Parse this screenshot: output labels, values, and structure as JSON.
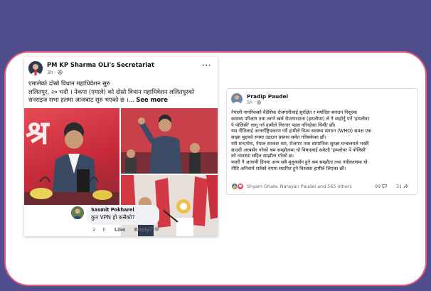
{
  "left_post": {
    "page_name": "PM KP Sharma OLI's Secretariat",
    "time": "3h",
    "privacy_icon": "globe-icon",
    "lines": [
      "एमालेको दोस्रो विधान महाधिवेशन सुरु",
      "ललितपुर, २० भदौ । नेकपा (एमाले) को दोस्रो विधान महाधिवेशन  ललितपुरको",
      "सनराइज सभा हलमा आजबाट सुरु भएको  छ ।..."
    ],
    "see_more": "See more",
    "photo_text": "श्र",
    "comment": {
      "author": "Sasmit Pokharel",
      "text": "कुन VPN हो कसैको?",
      "like": "Like",
      "reply": "Reply",
      "age": "2"
    }
  },
  "right_post": {
    "author": "Pradip Paudel",
    "time": "5h",
    "privacy_icon": "globe-icon",
    "lines": [
      "नेपाली नागरिकको वैदेशिक रोजगारीलाई सुरक्षित  र मर्यादित बनाउन निशुल्क",
      "स्वास्थ्य परिक्षण तथा लाग्ने खर्च रोजगारदाता (इम्प्लोयर) ले नै व्यहोर्नु पर्ने 'इम्प्लोयर",
      "पे पोलिसी' लागु गर्न हामीले निरन्तर पहल गरिरहेका थियौं/ छौं।",
      "यस नीतिलाई अन्तर्राष्ट्रियकरण गर्दै हामीले विश्व स्वास्थ्य संगठन (WHO) समक्ष एक",
      "साझा मुद्दाको रुपमा उठाउन प्रस्ताव समेत गरिसकेका छौं।",
      "यसै सन्दर्भमा, नेपाल सरकार श्रम, रोजगार तथा सामाजिक सुरक्षा मन्त्रालयले भर्खरै",
      "साउदी अरबसँग गरेको श्रम सम्झौतामा यो विषयलाई समेटदै 'इम्प्लोयर पे पोलिसी'",
      "को व्यवस्था सहित सम्झौता गरेको छ।",
      "यसरी नै आगामी दिनमा अन्य सबै मुलुकसँग हुने श्रम सम्झौता तथा नवीकरणमा यो",
      "नीति अनिवार्य शर्तको रुपमा स्थापित हुने विश्वास हामीले लिएका छौं।"
    ],
    "reactions_text": "Shyam Ghale, Narayan Paudel and 565 others",
    "comments_count": "99",
    "shares_count": "31"
  }
}
